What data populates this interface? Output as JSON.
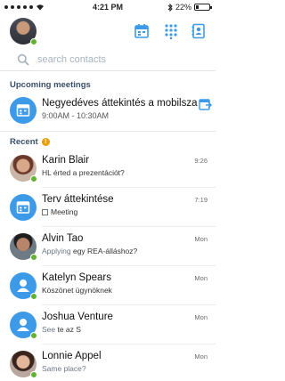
{
  "status_bar": {
    "time": "4:21 PM",
    "battery": "22%",
    "battery_level": 0.22
  },
  "header": {
    "icons": [
      "calendar-icon",
      "dialpad-icon",
      "contacts-book-icon"
    ]
  },
  "search": {
    "placeholder": "search contacts"
  },
  "upcoming": {
    "heading": "Upcoming meetings",
    "meeting": {
      "title": "Negyedéves áttekintés a mobilszapattól",
      "time": "9:00AM - 10:30AM"
    }
  },
  "recent": {
    "heading": "Recent",
    "badge": "!",
    "items": [
      {
        "name": "Karin Blair",
        "lead": "",
        "sub": "HL érted a prezentációt?",
        "time": "9:26",
        "presence": "available",
        "avatar": "photo"
      },
      {
        "name": "Terv áttekintése",
        "lead": "",
        "sub": "Meeting",
        "time": "7:19",
        "presence": "",
        "avatar": "meeting"
      },
      {
        "name": "Alvin Tao",
        "lead": "Applying",
        "sub": " egy REA-álláshoz?",
        "time": "Mon",
        "presence": "available",
        "avatar": "photo"
      },
      {
        "name": "Katelyn Spears",
        "lead": "",
        "sub": "Köszönet ügynöknek",
        "time": "Mon",
        "presence": "available",
        "avatar": "generic"
      },
      {
        "name": "Joshua Venture",
        "lead": "See",
        "sub": " te az S",
        "time": "Mon",
        "presence": "available",
        "avatar": "generic"
      },
      {
        "name": "Lonnie Appel",
        "lead": "Same place?",
        "sub": "",
        "time": "Mon",
        "presence": "available",
        "avatar": "photo"
      }
    ]
  },
  "colors": {
    "accent": "#3d9ae8",
    "presence_available": "#5fb32d",
    "badge": "#e6a000"
  }
}
